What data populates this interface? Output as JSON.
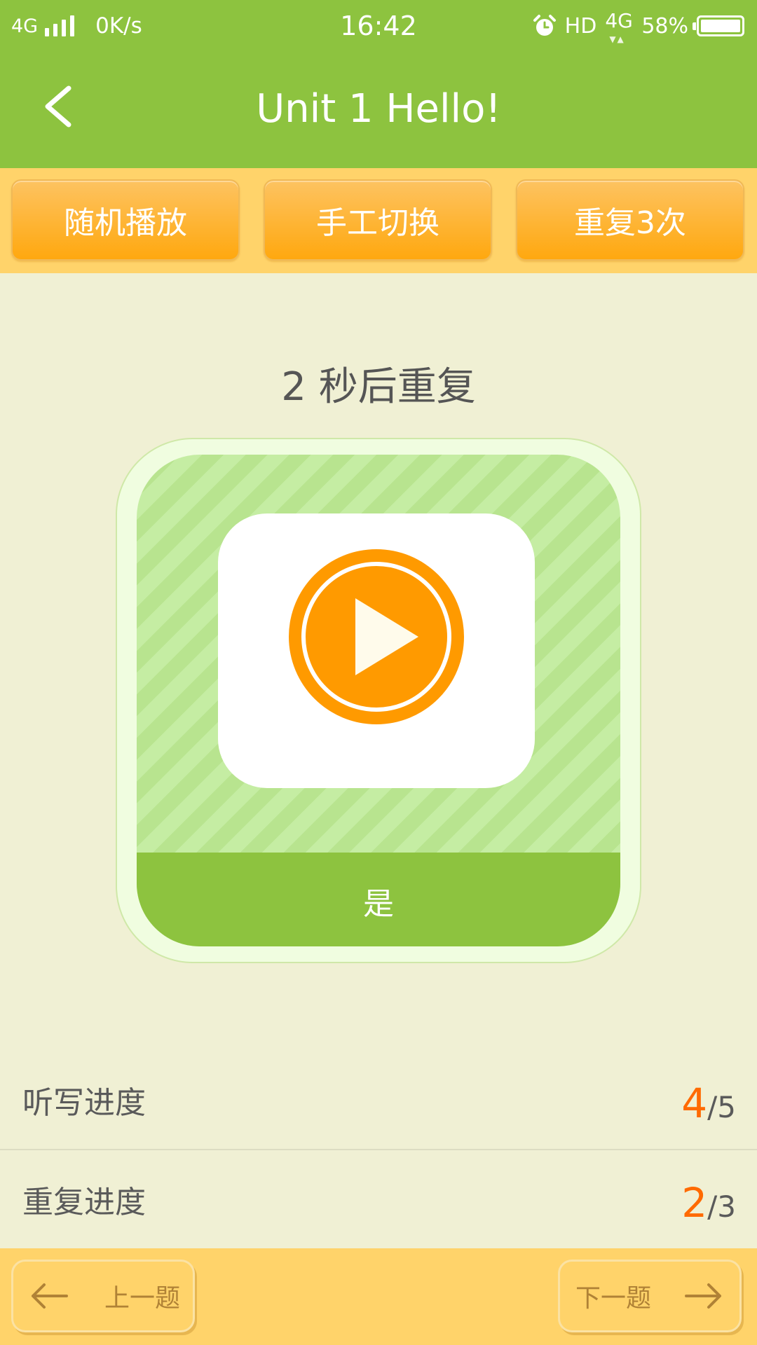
{
  "status_bar": {
    "network": "4G",
    "speed": "0K/s",
    "time": "16:42",
    "hd": "HD",
    "network_right": "4G",
    "battery": "58%"
  },
  "header": {
    "title": "Unit 1 Hello!"
  },
  "modes": [
    {
      "label": "随机播放"
    },
    {
      "label": "手工切换"
    },
    {
      "label": "重复3次"
    }
  ],
  "countdown_text": "2 秒后重复",
  "card": {
    "answer": "是"
  },
  "progress": {
    "dictation": {
      "label": "听写进度",
      "current": "4",
      "total": "/5"
    },
    "repeat": {
      "label": "重复进度",
      "current": "2",
      "total": "/3"
    }
  },
  "navigation": {
    "prev_label": "上一题",
    "next_label": "下一题"
  },
  "colors": {
    "primary_green": "#8dc33f",
    "accent_orange": "#ff9a00",
    "progress_orange": "#ff6a00",
    "bar_yellow": "#ffd36a",
    "background": "#f0f0d4"
  }
}
